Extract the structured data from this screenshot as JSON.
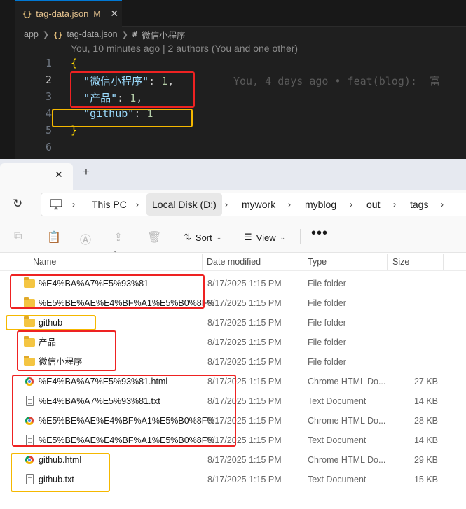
{
  "editor": {
    "tab": {
      "name": "tag-data.json",
      "modified": "M",
      "icon": "json-braces-icon"
    },
    "breadcrumb": {
      "root": "app",
      "file": "tag-data.json",
      "symbol": "微信小程序"
    },
    "codelens": "You, 10 minutes ago | 2 authors (You and one other)",
    "lines": [
      {
        "no": "1",
        "open": "{"
      },
      {
        "no": "2",
        "key": "\"微信小程序\"",
        "value": "1",
        "blame": "You, 4 days ago • feat(blog):  富"
      },
      {
        "no": "3",
        "key": "\"产品\"",
        "value": "1"
      },
      {
        "no": "4",
        "key": "\"github\"",
        "value": "1"
      },
      {
        "no": "5",
        "close": "}"
      },
      {
        "no": "6"
      }
    ],
    "colors": {
      "background": "#1f1f1f",
      "key": "#9cdcfe",
      "number": "#b5cea8",
      "brace": "#ffd700"
    }
  },
  "explorer": {
    "new_tab": "+",
    "address": {
      "segments": [
        "This PC",
        "Local Disk (D:)",
        "mywork",
        "myblog",
        "out",
        "tags"
      ]
    },
    "toolbar": {
      "sort": "Sort",
      "view": "View",
      "more": "•••"
    },
    "columns": {
      "name": "Name",
      "date": "Date modified",
      "type": "Type",
      "size": "Size"
    },
    "rows": [
      {
        "name": "%E4%BA%A7%E5%93%81",
        "date": "8/17/2025 1:15 PM",
        "type": "File folder",
        "size": "",
        "icon": "folder-icon"
      },
      {
        "name": "%E5%BE%AE%E4%BF%A1%E5%B0%8F%...",
        "date": "8/17/2025 1:15 PM",
        "type": "File folder",
        "size": "",
        "icon": "folder-icon"
      },
      {
        "name": "github",
        "date": "8/17/2025 1:15 PM",
        "type": "File folder",
        "size": "",
        "icon": "folder-icon"
      },
      {
        "name": "产品",
        "date": "8/17/2025 1:15 PM",
        "type": "File folder",
        "size": "",
        "icon": "folder-icon"
      },
      {
        "name": "微信小程序",
        "date": "8/17/2025 1:15 PM",
        "type": "File folder",
        "size": "",
        "icon": "folder-icon"
      },
      {
        "name": "%E4%BA%A7%E5%93%81.html",
        "date": "8/17/2025 1:15 PM",
        "type": "Chrome HTML Do...",
        "size": "27 KB",
        "icon": "chrome-icon"
      },
      {
        "name": "%E4%BA%A7%E5%93%81.txt",
        "date": "8/17/2025 1:15 PM",
        "type": "Text Document",
        "size": "14 KB",
        "icon": "text-file-icon"
      },
      {
        "name": "%E5%BE%AE%E4%BF%A1%E5%B0%8F%...",
        "date": "8/17/2025 1:15 PM",
        "type": "Chrome HTML Do...",
        "size": "28 KB",
        "icon": "chrome-icon"
      },
      {
        "name": "%E5%BE%AE%E4%BF%A1%E5%B0%8F%...",
        "date": "8/17/2025 1:15 PM",
        "type": "Text Document",
        "size": "14 KB",
        "icon": "text-file-icon"
      },
      {
        "name": "github.html",
        "date": "8/17/2025 1:15 PM",
        "type": "Chrome HTML Do...",
        "size": "29 KB",
        "icon": "chrome-icon"
      },
      {
        "name": "github.txt",
        "date": "8/17/2025 1:15 PM",
        "type": "Text Document",
        "size": "15 KB",
        "icon": "text-file-icon"
      }
    ]
  },
  "annotation_colors": {
    "red": "#ee2222",
    "yellow": "#f5b800"
  }
}
